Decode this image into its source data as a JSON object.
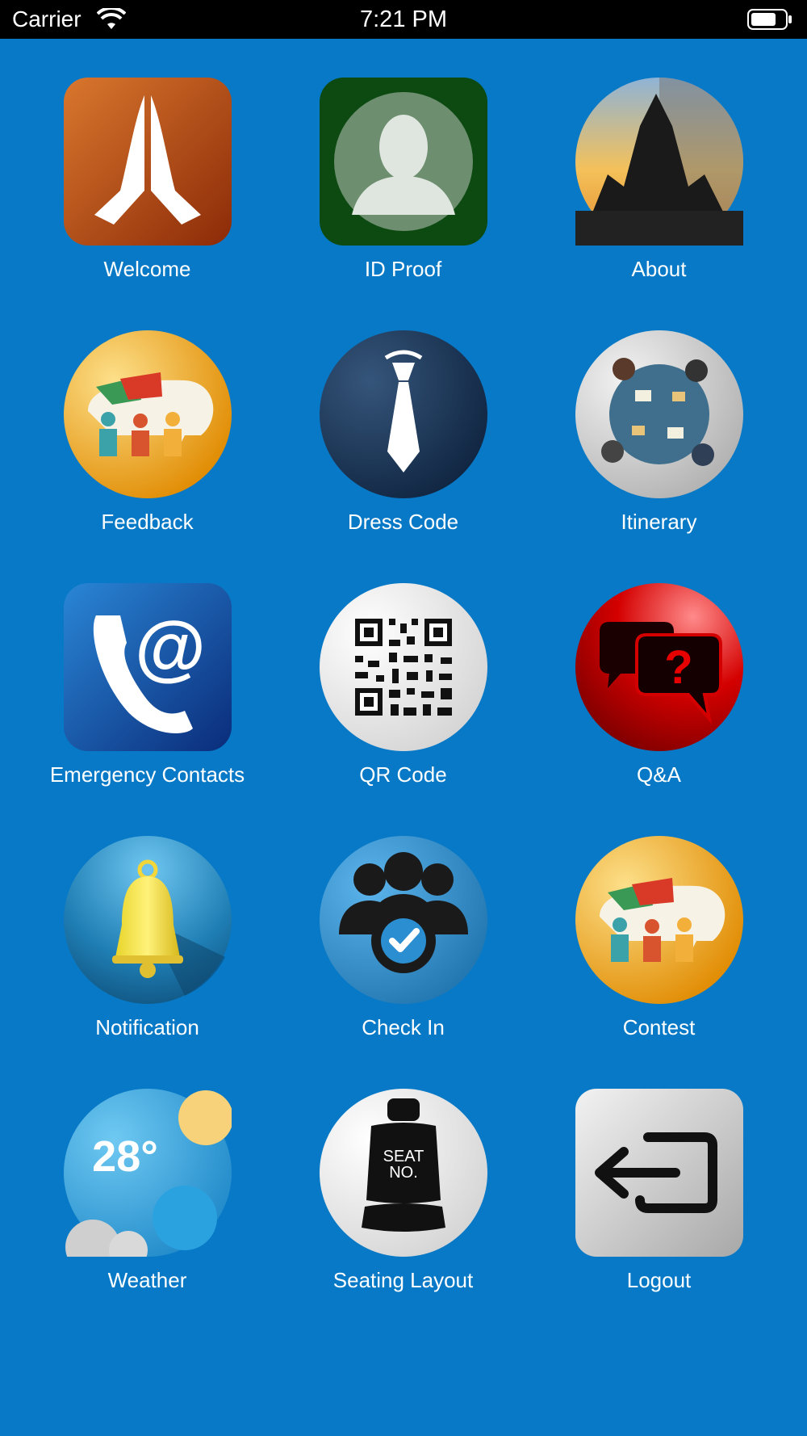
{
  "status_bar": {
    "carrier": "Carrier",
    "time": "7:21 PM"
  },
  "colors": {
    "background": "#0879c6",
    "label": "#ffffff"
  },
  "menu": [
    {
      "id": "welcome",
      "label": "Welcome",
      "icon": "praying-hands-icon"
    },
    {
      "id": "id-proof",
      "label": "ID Proof",
      "icon": "user-silhouette-icon"
    },
    {
      "id": "about",
      "label": "About",
      "icon": "temple-photo-icon"
    },
    {
      "id": "feedback",
      "label": "Feedback",
      "icon": "group-chat-icon"
    },
    {
      "id": "dress-code",
      "label": "Dress Code",
      "icon": "tie-icon"
    },
    {
      "id": "itinerary",
      "label": "Itinerary",
      "icon": "meeting-table-icon"
    },
    {
      "id": "emergency-contacts",
      "label": "Emergency Contacts",
      "icon": "phone-at-icon"
    },
    {
      "id": "qr-code",
      "label": "QR Code",
      "icon": "qr-code-icon"
    },
    {
      "id": "qa",
      "label": "Q&A",
      "icon": "question-bubbles-icon"
    },
    {
      "id": "notification",
      "label": "Notification",
      "icon": "bell-icon"
    },
    {
      "id": "check-in",
      "label": "Check In",
      "icon": "group-check-icon"
    },
    {
      "id": "contest",
      "label": "Contest",
      "icon": "group-chat-icon"
    },
    {
      "id": "weather",
      "label": "Weather",
      "icon": "weather-icon",
      "temperature": "28°"
    },
    {
      "id": "seating-layout",
      "label": "Seating Layout",
      "icon": "seat-icon",
      "seat_text_1": "SEAT",
      "seat_text_2": "NO."
    },
    {
      "id": "logout",
      "label": "Logout",
      "icon": "logout-arrow-icon"
    }
  ]
}
